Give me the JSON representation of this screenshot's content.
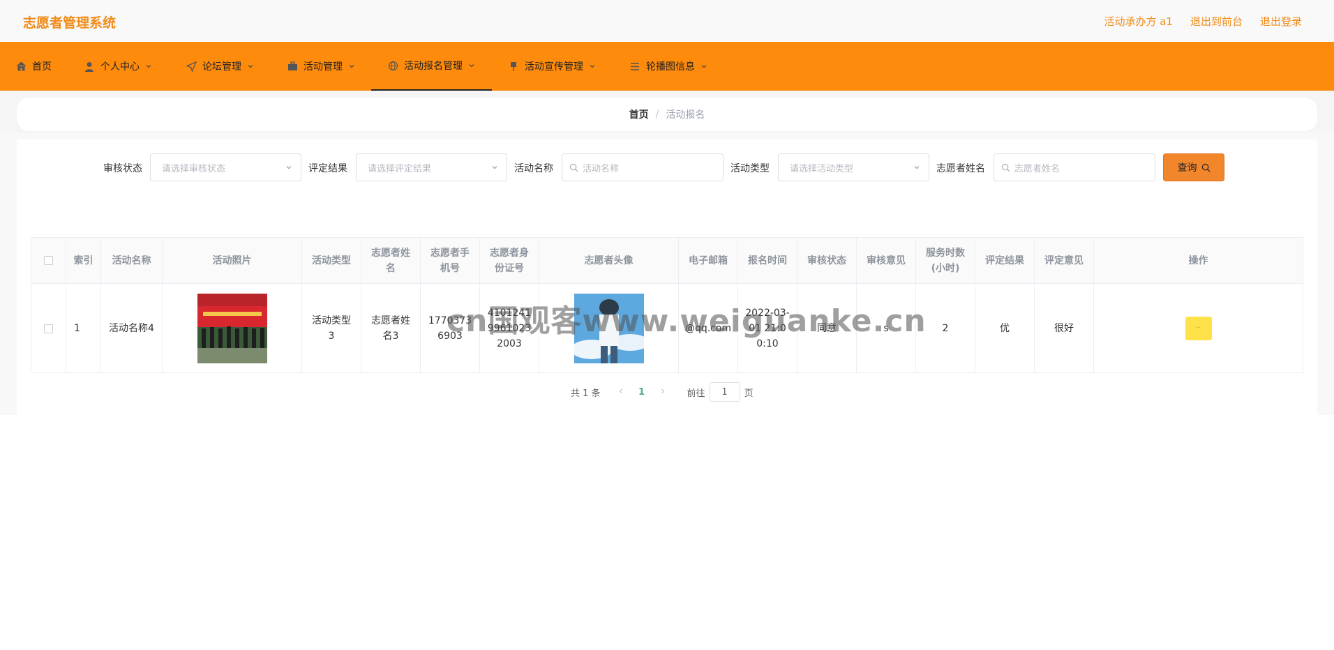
{
  "header": {
    "app_title": "志愿者管理系统",
    "user_label": "活动承办方 a1",
    "front_link": "退出到前台",
    "logout_link": "退出登录"
  },
  "nav": {
    "items": [
      {
        "label": "首页",
        "icon": "home-icon"
      },
      {
        "label": "个人中心",
        "icon": "user-icon"
      },
      {
        "label": "论坛管理",
        "icon": "send-icon"
      },
      {
        "label": "活动管理",
        "icon": "suitcase-icon"
      },
      {
        "label": "活动报名管理",
        "icon": "globe-icon",
        "active": true
      },
      {
        "label": "活动宣传管理",
        "icon": "pin-icon"
      },
      {
        "label": "轮播图信息",
        "icon": "list-icon"
      }
    ]
  },
  "breadcrumb": {
    "home": "首页",
    "separator": "/",
    "current": "活动报名"
  },
  "filters": {
    "audit_status_label": "审核状态",
    "audit_status_placeholder": "请选择审核状态",
    "eval_result_label": "评定结果",
    "eval_result_placeholder": "请选择评定结果",
    "activity_name_label": "活动名称",
    "activity_name_placeholder": "活动名称",
    "activity_type_label": "活动类型",
    "activity_type_placeholder": "请选择活动类型",
    "volunteer_name_label": "志愿者姓名",
    "volunteer_name_placeholder": "志愿者姓名",
    "search_button": "查询"
  },
  "table": {
    "headers": {
      "index": "索引",
      "activity_name": "活动名称",
      "activity_photo": "活动照片",
      "activity_type": "活动类型",
      "volunteer_name": "志愿者姓名",
      "volunteer_phone": "志愿者手机号",
      "volunteer_id": "志愿者身份证号",
      "volunteer_avatar": "志愿者头像",
      "email": "电子邮箱",
      "signup_time": "报名时间",
      "audit_status": "审核状态",
      "audit_opinion": "审核意见",
      "service_hours": "服务时数(小时)",
      "eval_result": "评定结果",
      "eval_opinion": "评定意见",
      "actions": "操作"
    },
    "rows": [
      {
        "index": "1",
        "activity_name": "活动名称4",
        "activity_type": "活动类型3",
        "volunteer_name": "志愿者姓名3",
        "volunteer_phone": "17703736903",
        "volunteer_id": "41012419961023 2003",
        "email": "@qq.com",
        "signup_time": "2022-03-01 21:00:10",
        "audit_status": "同意",
        "audit_opinion": "s",
        "service_hours": "2",
        "eval_result": "优",
        "eval_opinion": "很好",
        "action_label": "··"
      }
    ]
  },
  "pagination": {
    "total": "共 1 条",
    "current_page": "1",
    "goto_label": "前往",
    "goto_value": "1",
    "page_suffix": "页"
  },
  "watermark": "cn国观客www.weiguanke.cn",
  "colors": {
    "accent_orange": "#ff8b0c",
    "title_orange": "#f08c1a",
    "search_button": "#f2862b",
    "action_button": "#ffe24a"
  }
}
